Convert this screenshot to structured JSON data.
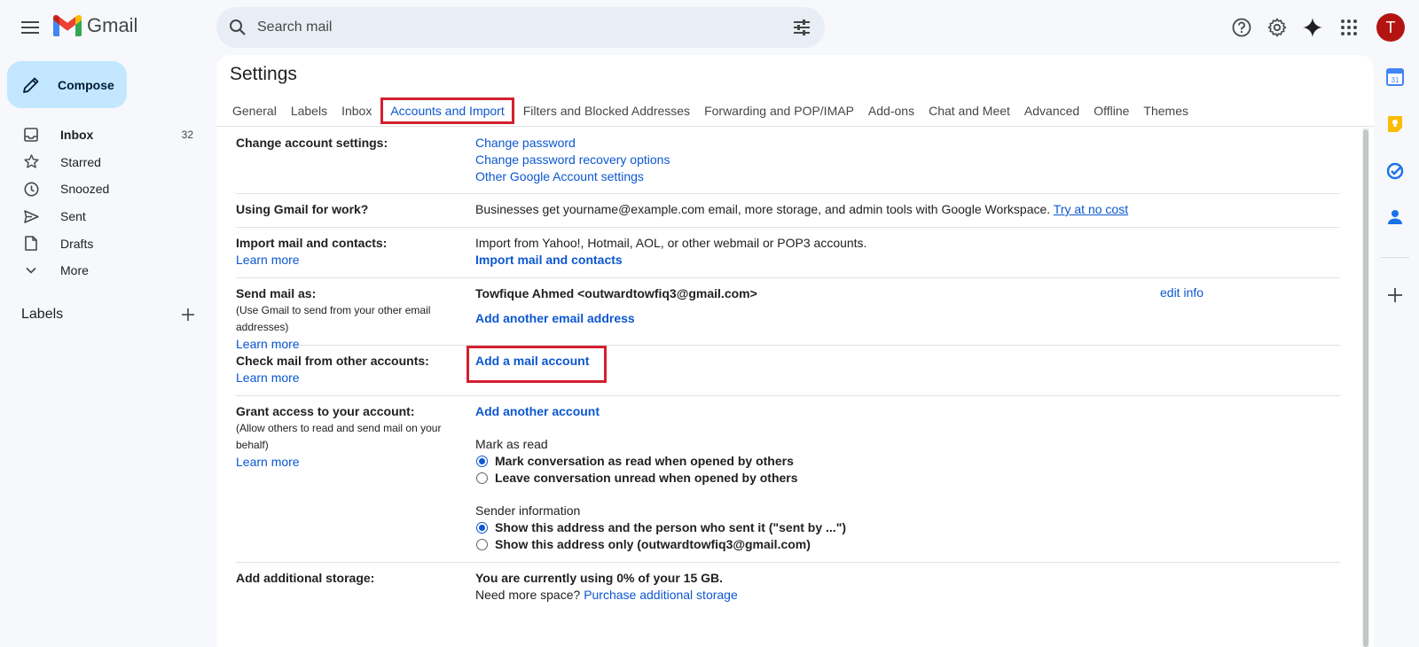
{
  "app": {
    "name": "Gmail"
  },
  "search": {
    "placeholder": "Search mail"
  },
  "compose": {
    "label": "Compose"
  },
  "nav": {
    "items": [
      {
        "label": "Inbox",
        "count": "32"
      },
      {
        "label": "Starred",
        "count": ""
      },
      {
        "label": "Snoozed",
        "count": ""
      },
      {
        "label": "Sent",
        "count": ""
      },
      {
        "label": "Drafts",
        "count": ""
      },
      {
        "label": "More",
        "count": ""
      }
    ]
  },
  "labels": {
    "header": "Labels"
  },
  "user": {
    "avatar_letter": "T"
  },
  "settings": {
    "title": "Settings",
    "tabs": [
      "General",
      "Labels",
      "Inbox",
      "Accounts and Import",
      "Filters and Blocked Addresses",
      "Forwarding and POP/IMAP",
      "Add-ons",
      "Chat and Meet",
      "Advanced",
      "Offline",
      "Themes"
    ],
    "active_tab": "Accounts and Import",
    "sections": {
      "change_account": {
        "label": "Change account settings:",
        "links": [
          "Change password",
          "Change password recovery options",
          "Other Google Account settings"
        ]
      },
      "work": {
        "label": "Using Gmail for work?",
        "text": "Businesses get yourname@example.com email, more storage, and admin tools with Google Workspace.",
        "link": "Try at no cost"
      },
      "import": {
        "label": "Import mail and contacts:",
        "learn_more": "Learn more",
        "text": "Import from Yahoo!, Hotmail, AOL, or other webmail or POP3 accounts.",
        "link": "Import mail and contacts"
      },
      "send_as": {
        "label": "Send mail as:",
        "sub": "(Use Gmail to send from your other email addresses)",
        "learn_more": "Learn more",
        "address": "Towfique Ahmed <outwardtowfiq3@gmail.com>",
        "edit": "edit info",
        "link": "Add another email address"
      },
      "check_mail": {
        "label": "Check mail from other accounts:",
        "learn_more": "Learn more",
        "link": "Add a mail account"
      },
      "grant": {
        "label": "Grant access to your account:",
        "sub": "(Allow others to read and send mail on your behalf)",
        "learn_more": "Learn more",
        "link": "Add another account",
        "mark_heading": "Mark as read",
        "mark_options": [
          "Mark conversation as read when opened by others",
          "Leave conversation unread when opened by others"
        ],
        "mark_selected": 0,
        "sender_heading": "Sender information",
        "sender_options": [
          "Show this address and the person who sent it (\"sent by ...\")",
          "Show this address only (outwardtowfiq3@gmail.com)"
        ],
        "sender_selected": 0
      },
      "storage": {
        "label": "Add additional storage:",
        "usage": "You are currently using 0% of your 15 GB.",
        "more_space": "Need more space?",
        "link": "Purchase additional storage"
      }
    }
  },
  "colors": {
    "accent": "#0b57d0",
    "highlight": "#d3202f",
    "compose_bg": "#c2e7ff",
    "avatar_bg": "#b31412"
  }
}
